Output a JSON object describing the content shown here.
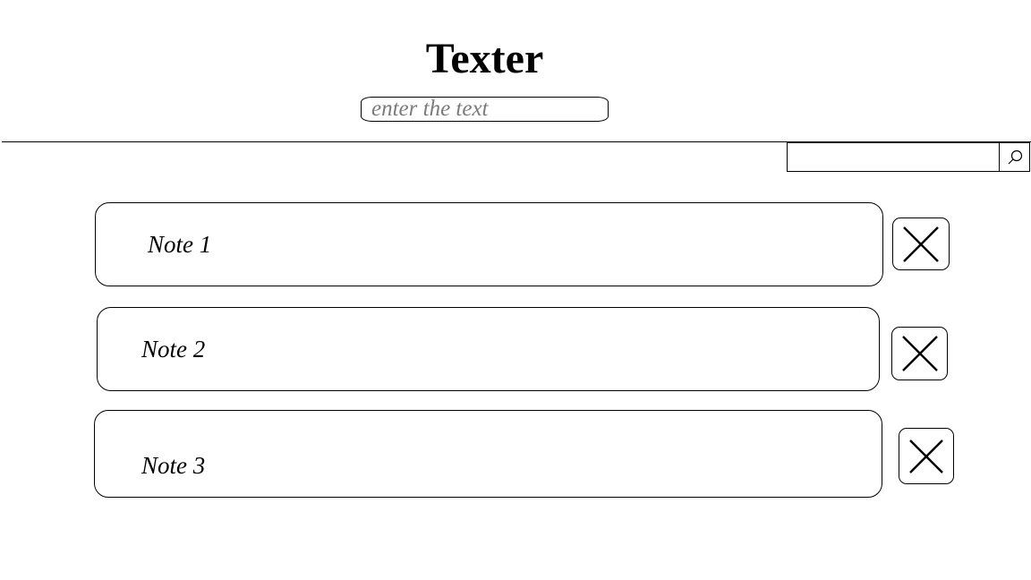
{
  "app": {
    "title": "Texter"
  },
  "new_note": {
    "placeholder": "enter the text",
    "value": ""
  },
  "search": {
    "value": "",
    "button_icon": "search-icon"
  },
  "notes": [
    {
      "text": "Note 1",
      "delete_icon": "close-icon"
    },
    {
      "text": "Note 2",
      "delete_icon": "close-icon"
    },
    {
      "text": "Note 3",
      "delete_icon": "close-icon"
    }
  ],
  "colors": {
    "border": "#000000",
    "placeholder": "#7b7b7b",
    "background": "#ffffff"
  }
}
